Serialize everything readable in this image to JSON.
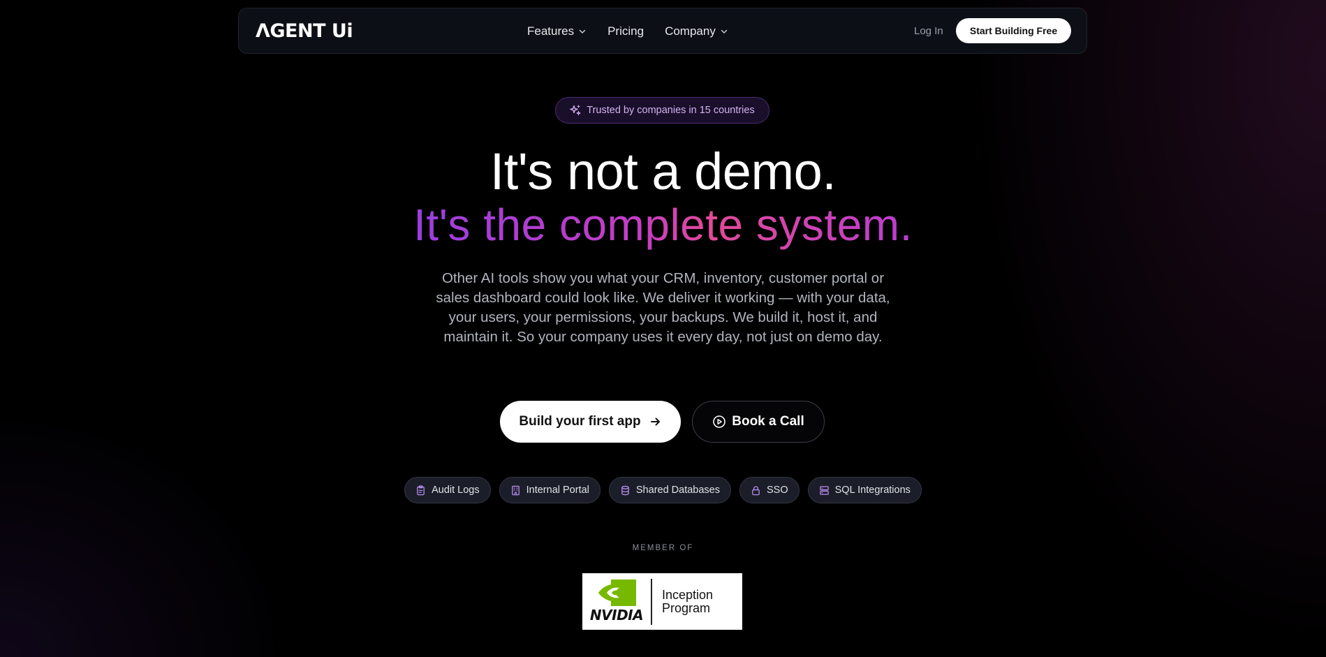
{
  "nav": {
    "logo": "ΛGENT Ui",
    "links": [
      {
        "label": "Features",
        "has_dropdown": true
      },
      {
        "label": "Pricing",
        "has_dropdown": false
      },
      {
        "label": "Company",
        "has_dropdown": true
      }
    ],
    "login_label": "Log In",
    "cta_label": "Start Building Free"
  },
  "hero": {
    "badge": "Trusted by companies in 15 countries",
    "badge_icon": "sparkles-icon",
    "title_line1": "It's not a demo.",
    "title_line2": "It's the complete system.",
    "description": "Other AI tools show you what your CRM, inventory, customer portal or sales dashboard could look like. We deliver it working — with your data, your users, your permissions, your backups. We build it, host it, and maintain it. So your company uses it every day, not just on demo day.",
    "primary_cta": "Build your first app",
    "secondary_cta": "Book a Call"
  },
  "features": [
    {
      "label": "Audit Logs",
      "icon": "clipboard-icon"
    },
    {
      "label": "Internal Portal",
      "icon": "building-icon"
    },
    {
      "label": "Shared Databases",
      "icon": "database-icon"
    },
    {
      "label": "SSO",
      "icon": "lock-icon"
    },
    {
      "label": "SQL Integrations",
      "icon": "server-icon"
    }
  ],
  "membership": {
    "label": "MEMBER OF",
    "logo_word": "NVIDIA",
    "program_line1": "Inception",
    "program_line2": "Program"
  },
  "colors": {
    "accent_purple": "#9a3ee0",
    "accent_pink": "#e24a98",
    "badge_text": "#d3b2f4",
    "nvidia_green": "#76b900"
  }
}
